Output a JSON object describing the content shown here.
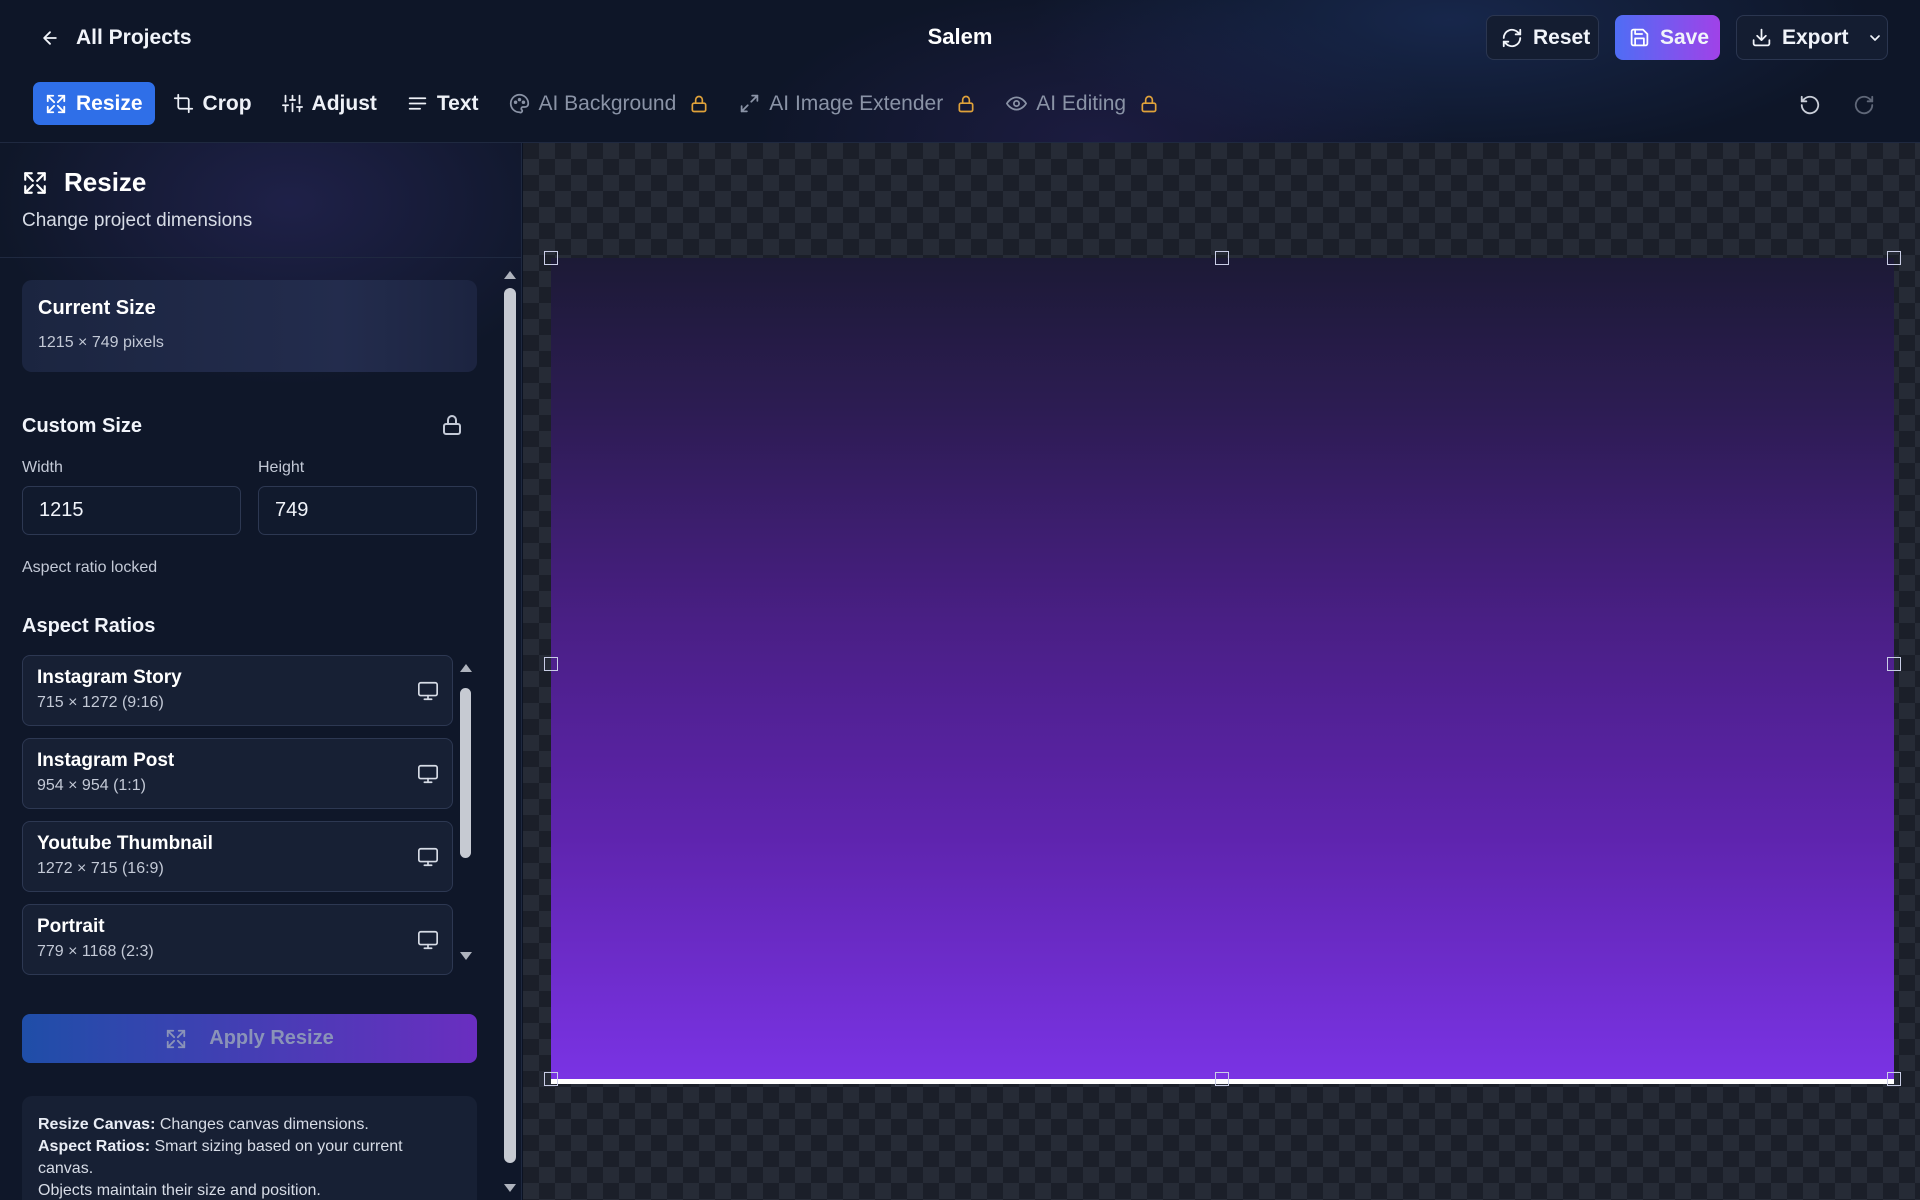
{
  "header": {
    "back_label": "All Projects",
    "project_title": "Salem",
    "reset_label": "Reset",
    "save_label": "Save",
    "export_label": "Export"
  },
  "toolbar": {
    "tools": [
      {
        "label": "Resize",
        "icon": "expand-icon",
        "active": true,
        "locked": false
      },
      {
        "label": "Crop",
        "icon": "crop-icon",
        "active": false,
        "locked": false
      },
      {
        "label": "Adjust",
        "icon": "sliders-icon",
        "active": false,
        "locked": false
      },
      {
        "label": "Text",
        "icon": "text-align-icon",
        "active": false,
        "locked": false
      },
      {
        "label": "AI Background",
        "icon": "palette-icon",
        "active": false,
        "locked": true
      },
      {
        "label": "AI Image Extender",
        "icon": "extend-icon",
        "active": false,
        "locked": true
      },
      {
        "label": "AI Editing",
        "icon": "eye-icon",
        "active": false,
        "locked": true
      }
    ],
    "undo_icon": "undo-icon",
    "redo_icon": "redo-icon"
  },
  "panel": {
    "title": "Resize",
    "subtitle": "Change project dimensions",
    "current_size": {
      "title": "Current Size",
      "value": "1215 × 749 pixels"
    },
    "custom_size": {
      "title": "Custom Size",
      "width_label": "Width",
      "height_label": "Height",
      "width_value": "1215",
      "height_value": "749",
      "hint": "Aspect ratio locked"
    },
    "aspect_ratios": {
      "title": "Aspect Ratios",
      "items": [
        {
          "name": "Instagram Story",
          "dims": "715 × 1272 (9:16)"
        },
        {
          "name": "Instagram Post",
          "dims": "954 × 954 (1:1)"
        },
        {
          "name": "Youtube Thumbnail",
          "dims": "1272 × 715 (16:9)"
        },
        {
          "name": "Portrait",
          "dims": "779 × 1168 (2:3)"
        }
      ]
    },
    "apply_label": "Apply Resize",
    "info": {
      "line1_bold": "Resize Canvas:",
      "line1_text": " Changes canvas dimensions.",
      "line2_bold": "Aspect Ratios:",
      "line2_text": " Smart sizing based on your current canvas.",
      "line3_text": "Objects maintain their size and position."
    }
  },
  "colors": {
    "accent": "#2f6fe8",
    "save_gradient_start": "#4f6df5",
    "save_gradient_end": "#a042e8",
    "lock": "#e0a23a"
  }
}
